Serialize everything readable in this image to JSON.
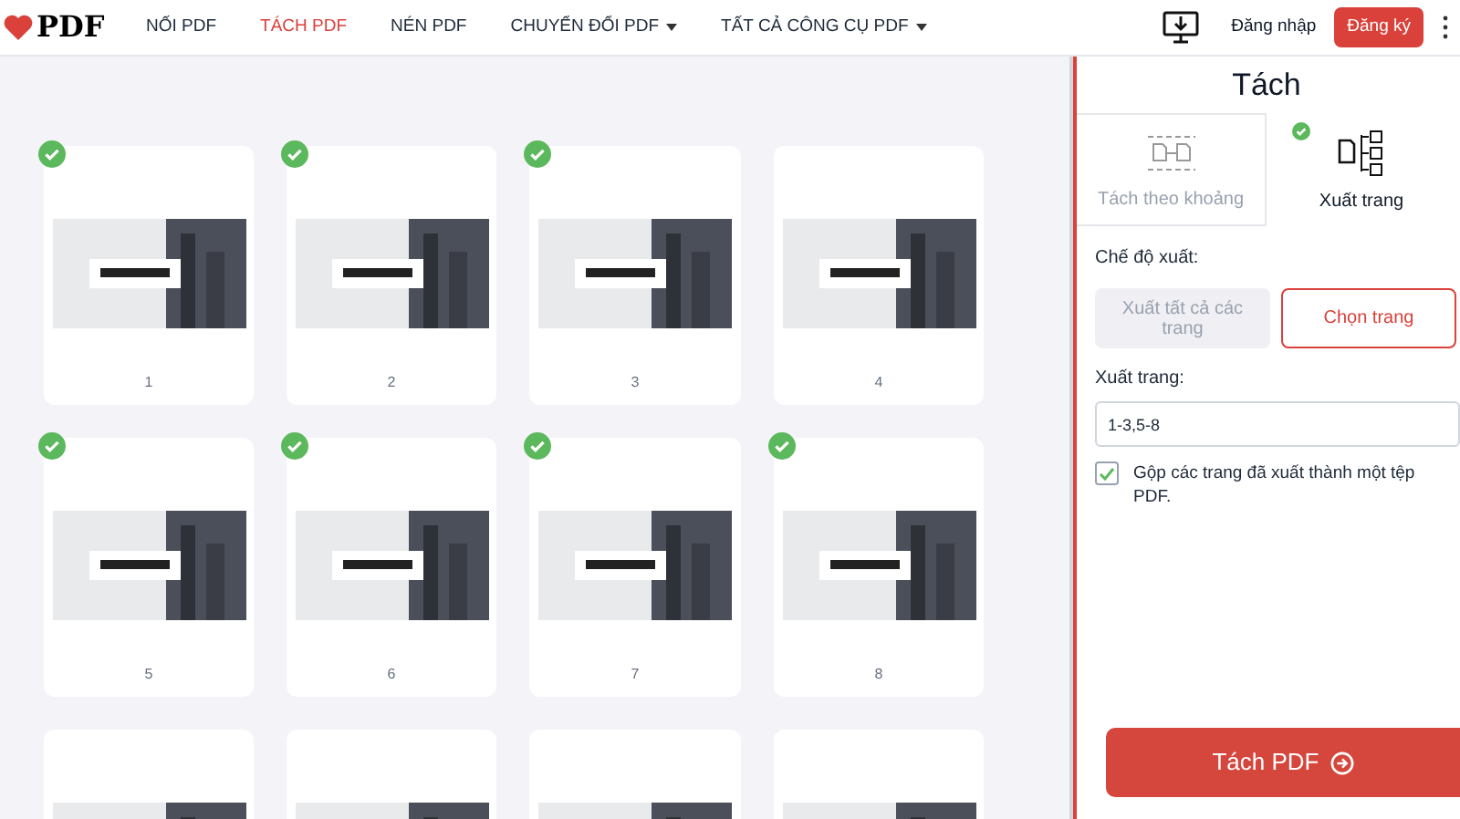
{
  "header": {
    "logo": "PDF",
    "nav": [
      {
        "label": "NỐI PDF",
        "selected": false,
        "dropdown": false
      },
      {
        "label": "TÁCH PDF",
        "selected": true,
        "dropdown": false
      },
      {
        "label": "NÉN PDF",
        "selected": false,
        "dropdown": false
      },
      {
        "label": "CHUYỂN ĐỔI PDF",
        "selected": false,
        "dropdown": true
      },
      {
        "label": "TẤT CẢ CÔNG CỤ PDF",
        "selected": false,
        "dropdown": true
      }
    ],
    "login": "Đăng nhập",
    "signup": "Đăng ký"
  },
  "pages": [
    {
      "number": "1",
      "selected": true
    },
    {
      "number": "2",
      "selected": true
    },
    {
      "number": "3",
      "selected": true
    },
    {
      "number": "4",
      "selected": false
    },
    {
      "number": "5",
      "selected": true
    },
    {
      "number": "6",
      "selected": true
    },
    {
      "number": "7",
      "selected": true
    },
    {
      "number": "8",
      "selected": true
    },
    {
      "selected": false
    },
    {
      "selected": false
    },
    {
      "selected": false
    },
    {
      "selected": false
    }
  ],
  "panel": {
    "title": "Tách",
    "tabs": [
      {
        "label": "Tách theo khoảng",
        "kind": "range",
        "selected": false
      },
      {
        "label": "Xuất trang",
        "kind": "extract",
        "selected": true
      }
    ],
    "mode_label": "Chế độ xuất:",
    "modes": [
      {
        "label": "Xuất tất cả các trang",
        "selected": false
      },
      {
        "label": "Chọn trang",
        "selected": true
      }
    ],
    "pages_label": "Xuất trang:",
    "pages_value": "1-3,5-8",
    "merge": {
      "label": "Gộp các trang đã xuất thành một tệp PDF.",
      "checked": true
    },
    "submit": "Tách PDF"
  }
}
